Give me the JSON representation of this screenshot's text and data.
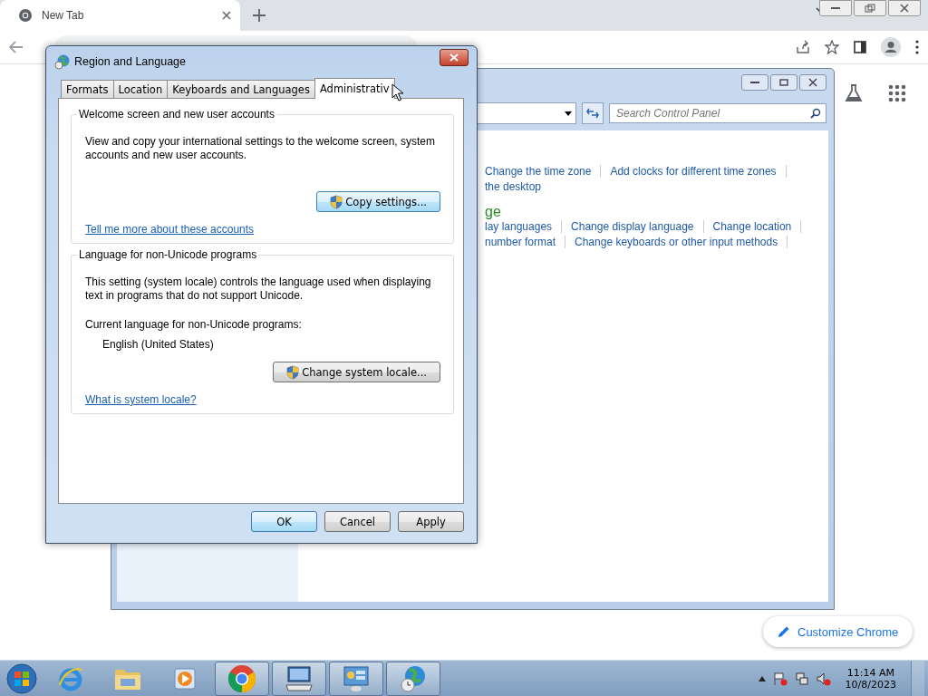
{
  "browser": {
    "tab": {
      "title": "New Tab"
    },
    "customize_button": "Customize Chrome"
  },
  "control_panel": {
    "search": {
      "placeholder": "Search Control Panel"
    },
    "sections": [
      {
        "rows": [
          [
            "Change the time zone",
            "Add clocks for different time zones"
          ],
          [
            "the desktop"
          ]
        ]
      },
      {
        "heading": "ge",
        "rows": [
          [
            "lay languages",
            "Change display language",
            "Change location"
          ],
          [
            "number format",
            "Change keyboards or other input methods"
          ]
        ]
      }
    ]
  },
  "dialog": {
    "title": "Region and Language",
    "tabs": [
      {
        "label": "Formats",
        "selected": false
      },
      {
        "label": "Location",
        "selected": false
      },
      {
        "label": "Keyboards and Languages",
        "selected": false
      },
      {
        "label": "Administrativ",
        "selected": true
      }
    ],
    "groups": [
      {
        "title": "Welcome screen and new user accounts",
        "text": "View and copy your international settings to the welcome screen, system accounts and new user accounts.",
        "button": "Copy settings...",
        "button_focused": true,
        "link": "Tell me more about these accounts"
      },
      {
        "title": "Language for non-Unicode programs",
        "text": "This setting (system locale) controls the language used when displaying text in programs that do not support Unicode.",
        "current_label": "Current language for non-Unicode programs:",
        "current_value": "English (United States)",
        "button": "Change system locale...",
        "button_focused": false,
        "link": "What is system locale?"
      }
    ],
    "buttons": [
      {
        "label": "OK",
        "default": true
      },
      {
        "label": "Cancel",
        "default": false
      },
      {
        "label": "Apply",
        "default": false
      }
    ]
  },
  "taskbar": {
    "items": [
      {
        "kind": "ie",
        "running": false
      },
      {
        "kind": "folder",
        "running": false
      },
      {
        "kind": "media",
        "running": false
      },
      {
        "kind": "chrome",
        "running": true
      },
      {
        "kind": "keyboard",
        "running": true
      },
      {
        "kind": "control",
        "running": true
      },
      {
        "kind": "globe",
        "running": true
      }
    ],
    "time": "11:14 AM",
    "date": "10/8/2023"
  }
}
